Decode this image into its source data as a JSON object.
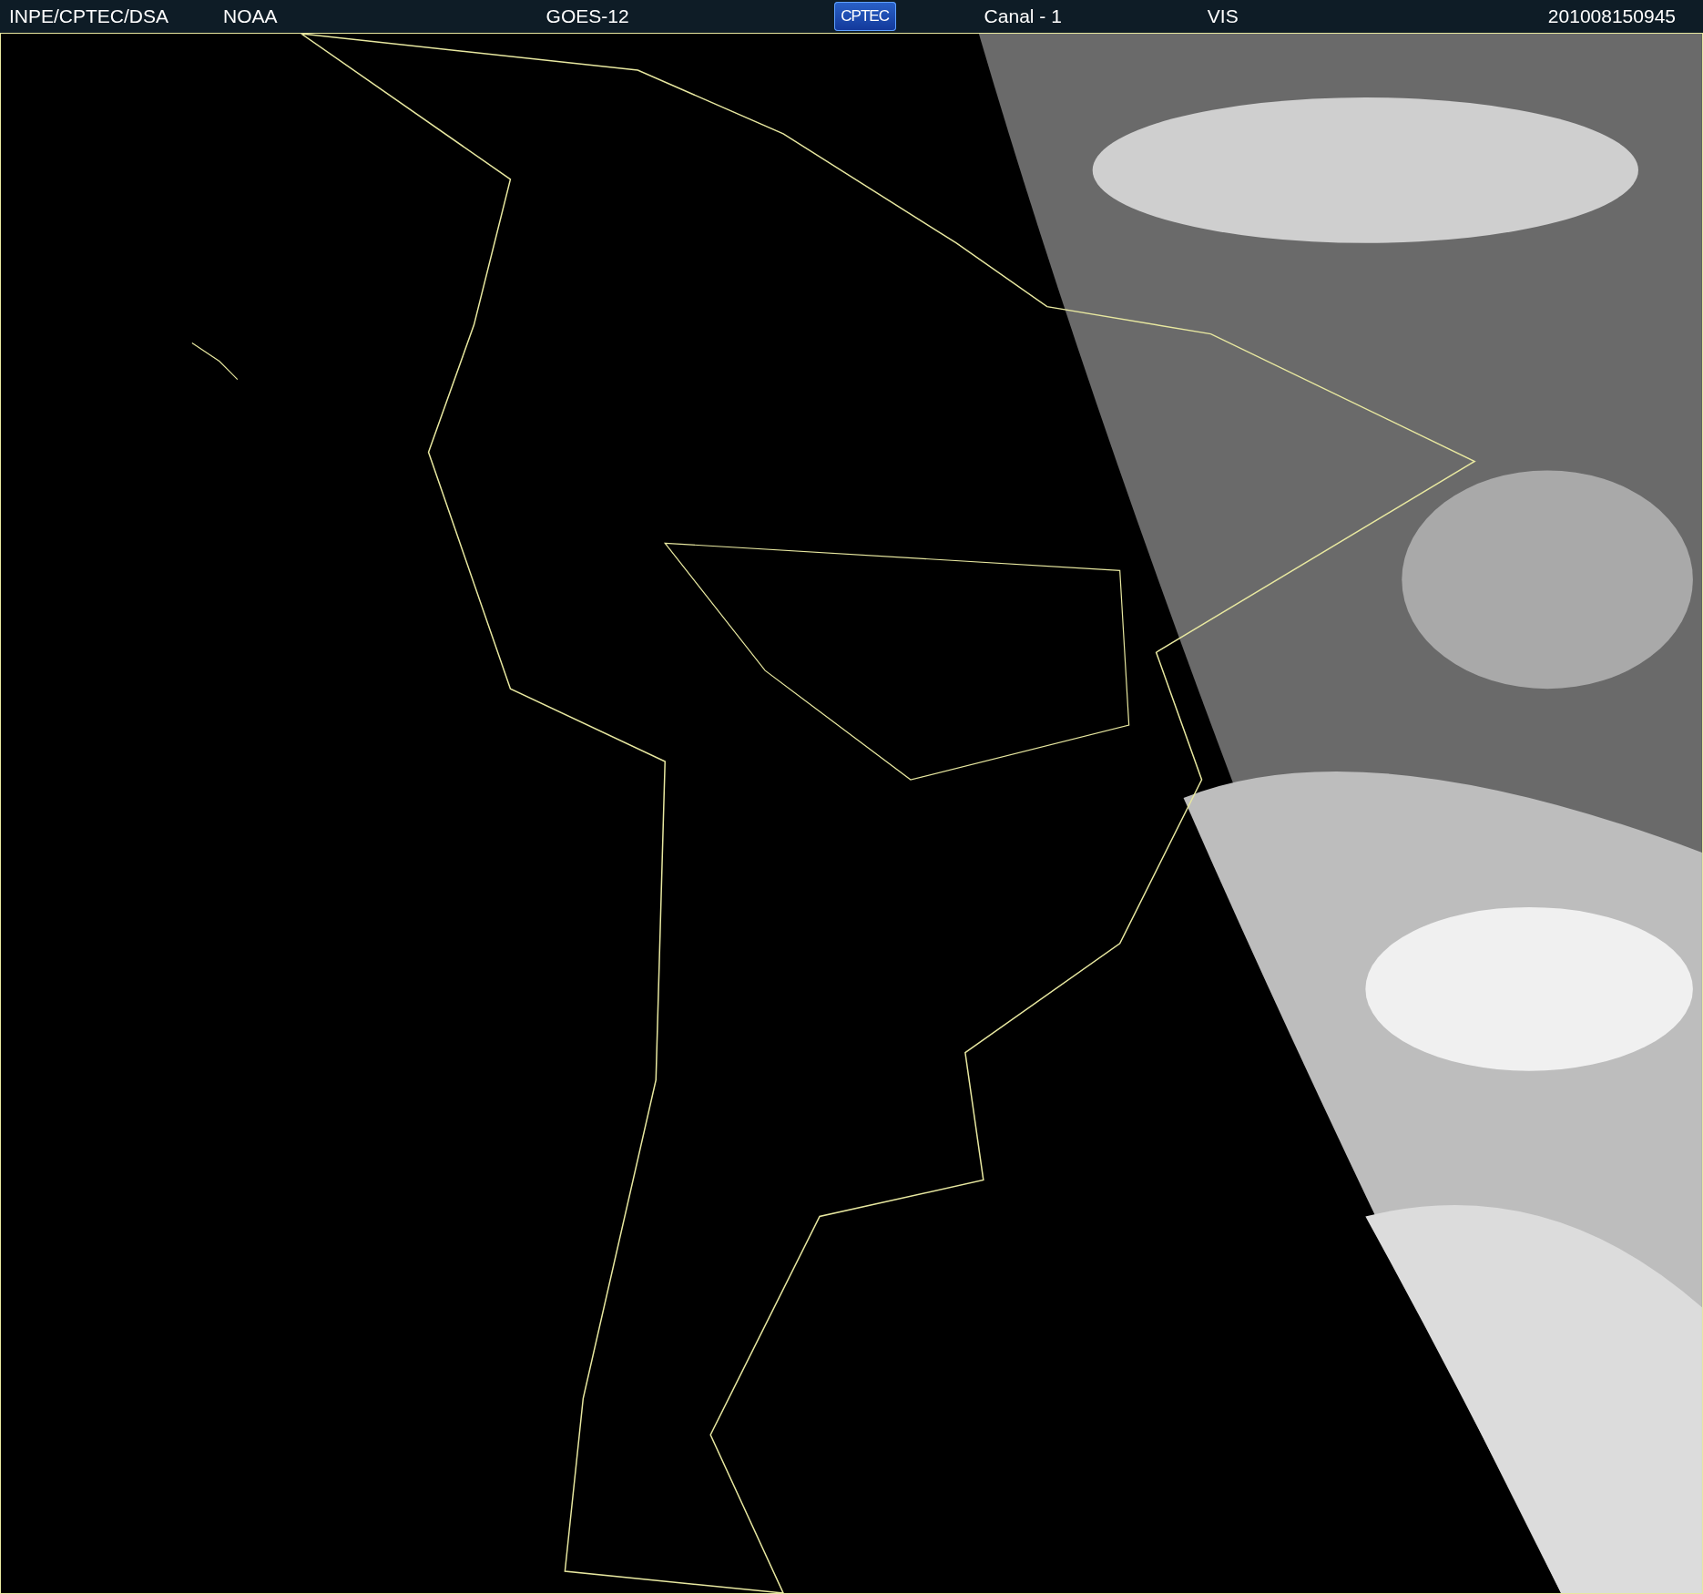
{
  "header": {
    "agency": "INPE/CPTEC/DSA",
    "operator": "NOAA",
    "satellite": "GOES-12",
    "logo": "CPTEC",
    "channel": "Canal - 1",
    "band": "VIS",
    "timestamp": "201008150945"
  }
}
